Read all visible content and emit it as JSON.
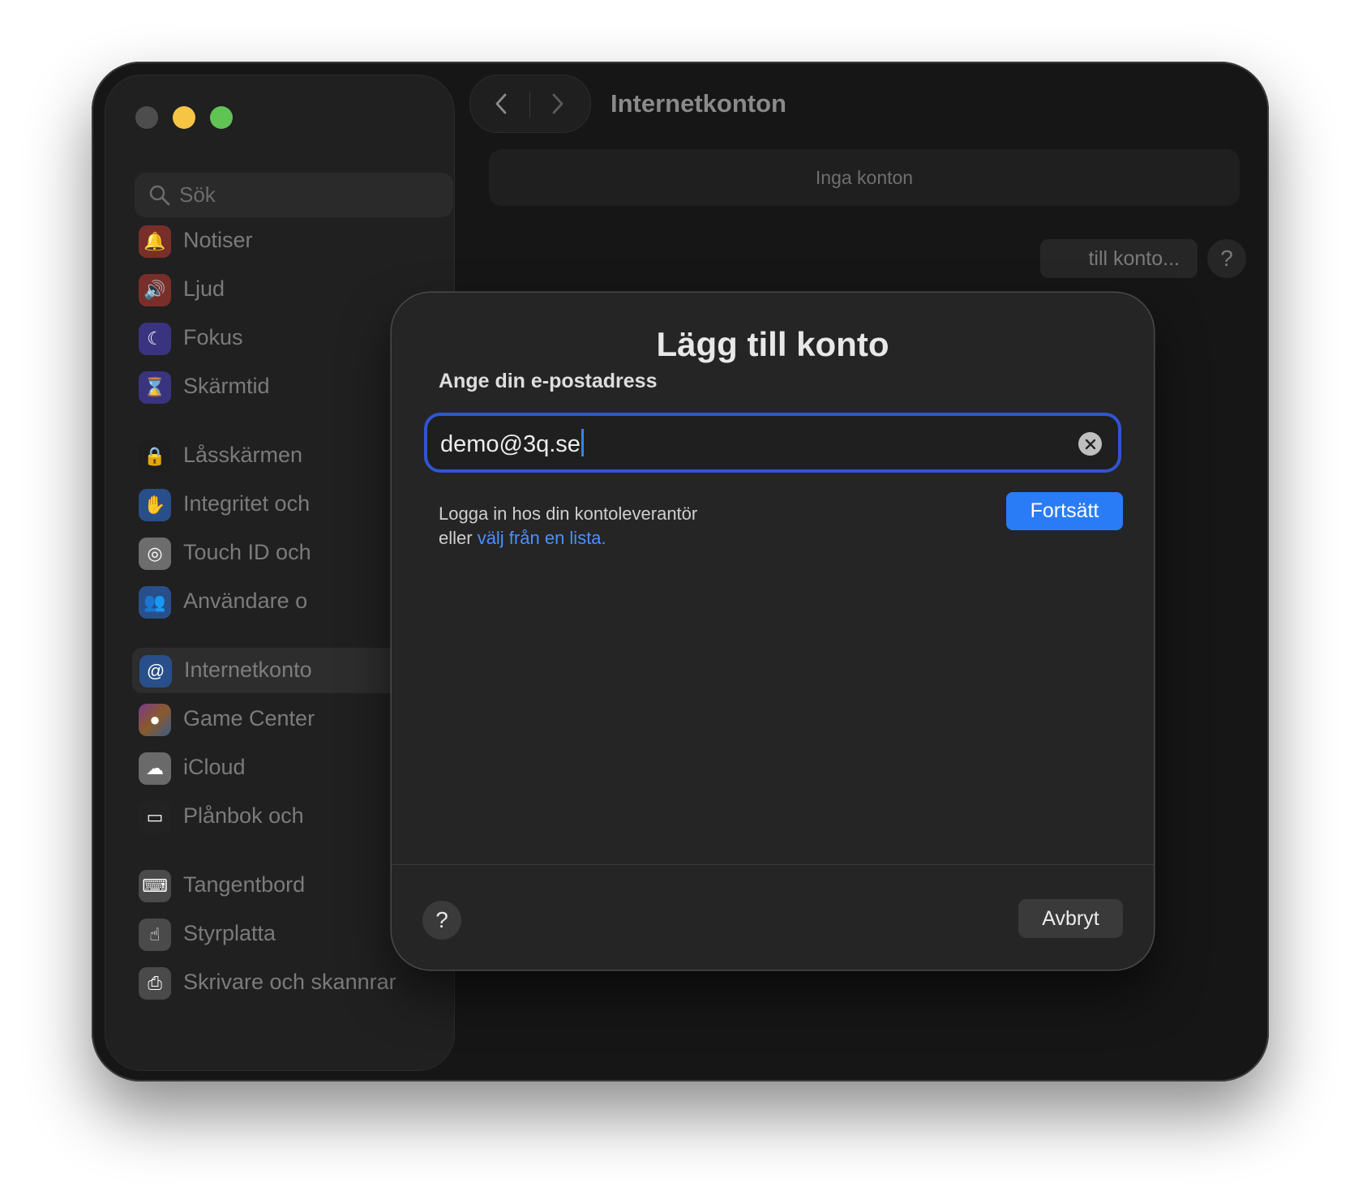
{
  "window": {
    "page_title": "Internetkonton"
  },
  "sidebar": {
    "search_placeholder": "Sök",
    "items": [
      {
        "label": "Notiser",
        "icon": "bell-icon",
        "color": "#c8443c"
      },
      {
        "label": "Ljud",
        "icon": "speaker-icon",
        "color": "#c8443c"
      },
      {
        "label": "Fokus",
        "icon": "moon-icon",
        "color": "#5a4fd1"
      },
      {
        "label": "Skärmtid",
        "icon": "hourglass-icon",
        "color": "#5a4fd1"
      },
      {
        "label": "Låsskärmen",
        "icon": "lock-icon",
        "color": "#2a2a2a"
      },
      {
        "label": "Integritet och",
        "icon": "hand-icon",
        "color": "#3a78d6"
      },
      {
        "label": "Touch ID och",
        "icon": "fingerprint-icon",
        "color": "#d9d9d9"
      },
      {
        "label": "Användare o",
        "icon": "users-icon",
        "color": "#3a78d6"
      },
      {
        "label": "Internetkonto",
        "icon": "at-sign-icon",
        "color": "#3a78d6"
      },
      {
        "label": "Game Center",
        "icon": "game-center-icon",
        "color": "#9a4ed0"
      },
      {
        "label": "iCloud",
        "icon": "cloud-icon",
        "color": "#e6e6e6"
      },
      {
        "label": "Plånbok och",
        "icon": "wallet-icon",
        "color": "#303030"
      },
      {
        "label": "Tangentbord",
        "icon": "keyboard-icon",
        "color": "#8a8a8a"
      },
      {
        "label": "Styrplatta",
        "icon": "trackpad-icon",
        "color": "#8a8a8a"
      },
      {
        "label": "Skrivare och skannrar",
        "icon": "printer-icon",
        "color": "#8a8a8a"
      }
    ]
  },
  "main": {
    "empty_label": "Inga konton",
    "add_account_label": "till konto...",
    "help_label": "?"
  },
  "dialog": {
    "title": "Lägg till konto",
    "subtitle": "Ange din e-postadress",
    "email_value": "demo@3q.se",
    "helper_line1": "Logga in hos din kontoleverantör",
    "helper_line2_prefix": "eller ",
    "helper_link": "välj från en lista.",
    "continue_label": "Fortsätt",
    "help_label": "?",
    "cancel_label": "Avbryt"
  }
}
